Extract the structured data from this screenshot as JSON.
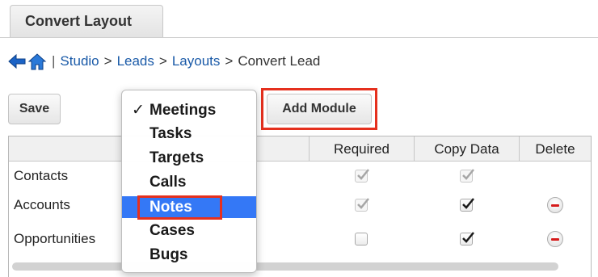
{
  "tab": {
    "label": "Convert Layout"
  },
  "nav": {
    "separator": "|",
    "crumbs": [
      "Studio",
      "Leads",
      "Layouts",
      "Convert Lead"
    ],
    "arrow": ">"
  },
  "toolbar": {
    "save_label": "Save",
    "add_module_label": "Add Module"
  },
  "grid": {
    "columns": {
      "required": "Required",
      "copy_data": "Copy Data",
      "delete": "Delete"
    },
    "rows": [
      {
        "name": "Contacts",
        "required": true,
        "required_disabled": true,
        "copy_data": true,
        "copy_disabled": true,
        "deletable": false
      },
      {
        "name": "Accounts",
        "required": true,
        "required_disabled": true,
        "copy_data": true,
        "copy_disabled": false,
        "deletable": true
      },
      {
        "name": "Opportunities",
        "required": false,
        "required_disabled": false,
        "copy_data": true,
        "copy_disabled": false,
        "deletable": true
      }
    ]
  },
  "module_menu": {
    "checked_mark": "✓",
    "options": [
      "Meetings",
      "Tasks",
      "Targets",
      "Calls",
      "Notes",
      "Cases",
      "Bugs"
    ],
    "checked": "Meetings",
    "highlighted": "Notes"
  },
  "colors": {
    "link": "#1a5aa8",
    "highlight_box": "#e5301e",
    "selection": "#3478f6"
  }
}
